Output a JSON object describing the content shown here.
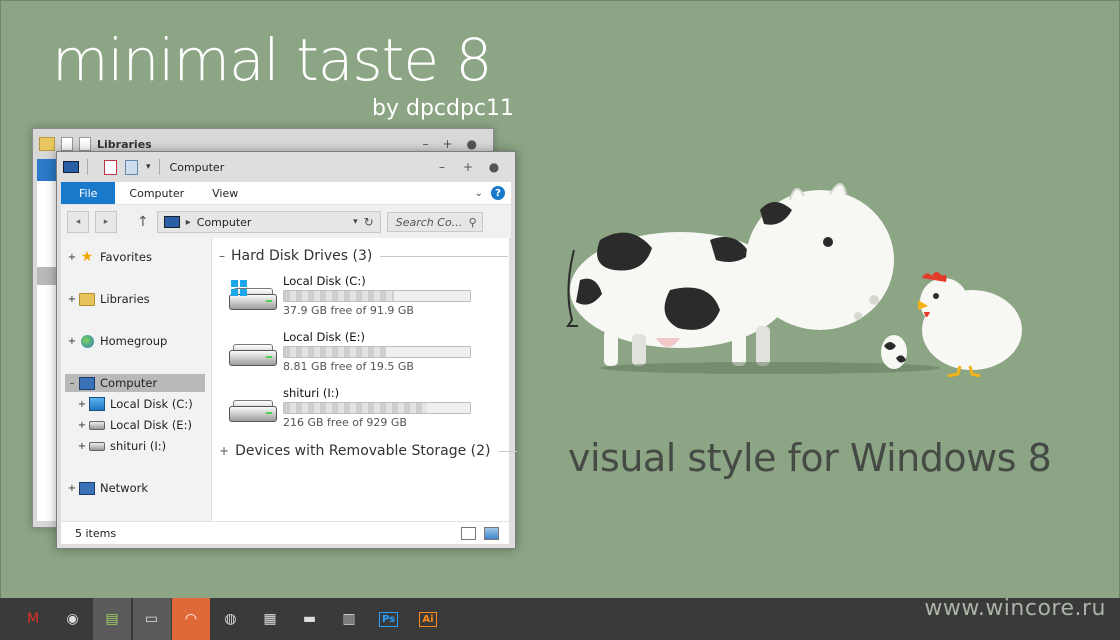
{
  "headline": "minimal taste 8",
  "byline": "by dpcdpc11",
  "tagline": "visual style for Windows 8",
  "watermark": "www.wincore.ru",
  "back_window": {
    "title": "Libraries"
  },
  "window": {
    "title": "Computer",
    "controls": {
      "minimize": "–",
      "maximize": "+",
      "close": "●"
    },
    "ribbon_tabs": [
      "File",
      "Computer",
      "View"
    ],
    "help": "?",
    "address": {
      "path": "Computer",
      "separator": "▸"
    },
    "search_placeholder": "Search Co...",
    "nav": [
      {
        "label": "Favorites",
        "icon": "star-icon"
      },
      {
        "label": "Libraries",
        "icon": "libraries-folder-icon"
      },
      {
        "label": "Homegroup",
        "icon": "homegroup-icon"
      },
      {
        "label": "Computer",
        "icon": "computer-icon"
      },
      {
        "label": "Local Disk (C:)",
        "icon": "system-drive-icon"
      },
      {
        "label": "Local Disk (E:)",
        "icon": "drive-icon"
      },
      {
        "label": "shituri (I:)",
        "icon": "drive-icon"
      },
      {
        "label": "Network",
        "icon": "network-icon"
      }
    ],
    "groups": {
      "hdd": "Hard Disk Drives (3)",
      "removable": "Devices with Removable Storage (2)"
    },
    "drives": [
      {
        "name": "Local Disk (C:)",
        "free": "37.9 GB free of 91.9 GB",
        "used_fraction": 0.59
      },
      {
        "name": "Local Disk (E:)",
        "free": "8.81 GB free of 19.5 GB",
        "used_fraction": 0.55
      },
      {
        "name": "shituri (I:)",
        "free": "216 GB free of 929 GB",
        "used_fraction": 0.77
      }
    ],
    "status": "5 items"
  },
  "taskbar": [
    {
      "name": "gmail",
      "glyph": "M",
      "color": "#d93025"
    },
    {
      "name": "chrome",
      "glyph": "◉",
      "color": "#dddddd"
    },
    {
      "name": "explorer",
      "glyph": "▤",
      "color": "#9fd06a"
    },
    {
      "name": "computer",
      "glyph": "▭",
      "color": "#dddddd"
    },
    {
      "name": "headphones",
      "glyph": "◠",
      "color": "#ffffff"
    },
    {
      "name": "firefox",
      "glyph": "◍",
      "color": "#dddddd"
    },
    {
      "name": "window",
      "glyph": "▦",
      "color": "#dddddd"
    },
    {
      "name": "clapper",
      "glyph": "▬",
      "color": "#dddddd"
    },
    {
      "name": "document",
      "glyph": "▥",
      "color": "#dddddd"
    },
    {
      "name": "photoshop",
      "glyph": "Ps",
      "color": "#2aa1ff"
    },
    {
      "name": "illustrator",
      "glyph": "Ai",
      "color": "#ff8a1a"
    }
  ]
}
